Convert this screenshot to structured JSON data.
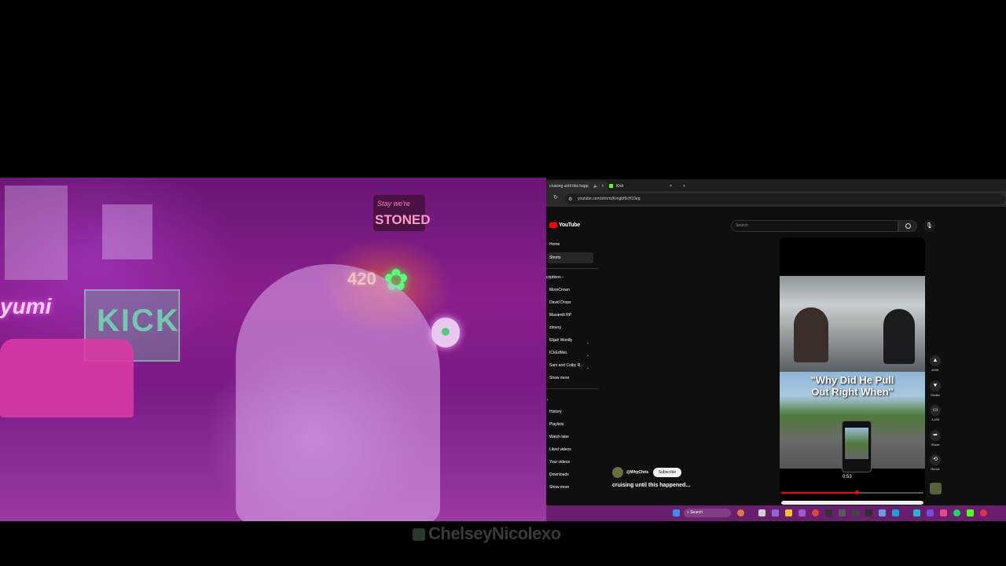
{
  "stream": {
    "neon_kick": "KICK",
    "neon_420": "420",
    "sign_top": "Stay we're",
    "sign_stoned": "STONED",
    "neon_left": "yumi",
    "watermark": "ChelseyNicolexo"
  },
  "browser": {
    "tabs": [
      {
        "label": "cruising until this happ",
        "active": true
      },
      {
        "label": "Kick",
        "active": false
      }
    ],
    "new_tab": "+",
    "url": "youtube.com/shorts/Kmgbf6cH10eg"
  },
  "youtube": {
    "logo": "YouTube",
    "search_placeholder": "Search",
    "nav": [
      "Home",
      "Shorts"
    ],
    "subs_header": "criptions",
    "subscriptions": [
      "MoreCrown",
      "David Drops",
      "Maxamili RP",
      "ztmery",
      "Elijah Wordly",
      "ICkEdMeL",
      "Sam and Colby R.."
    ],
    "show_more": "Show more",
    "you_items": [
      "History",
      "Playlists",
      "Watch later",
      "Liked videos",
      "Your videos",
      "Downloads"
    ],
    "show_more_2": "Show more",
    "short": {
      "caption_line1": "\"Why Did He Pull",
      "caption_line2": "Out Right When\"",
      "time": "0:53",
      "channel": "@WhyChris",
      "subscribe": "Subscribe",
      "title": "cruising until this happened..."
    },
    "actions": {
      "likes": "820K",
      "dislike": "Dislike",
      "comments": "4,430",
      "share": "Share",
      "remix": "Remix"
    }
  },
  "taskbar": {
    "search": "Search"
  },
  "colors": {
    "youtube_red": "#ff0000",
    "kick_green": "#53fc18",
    "taskbar_purple": "#6a1f6e"
  }
}
